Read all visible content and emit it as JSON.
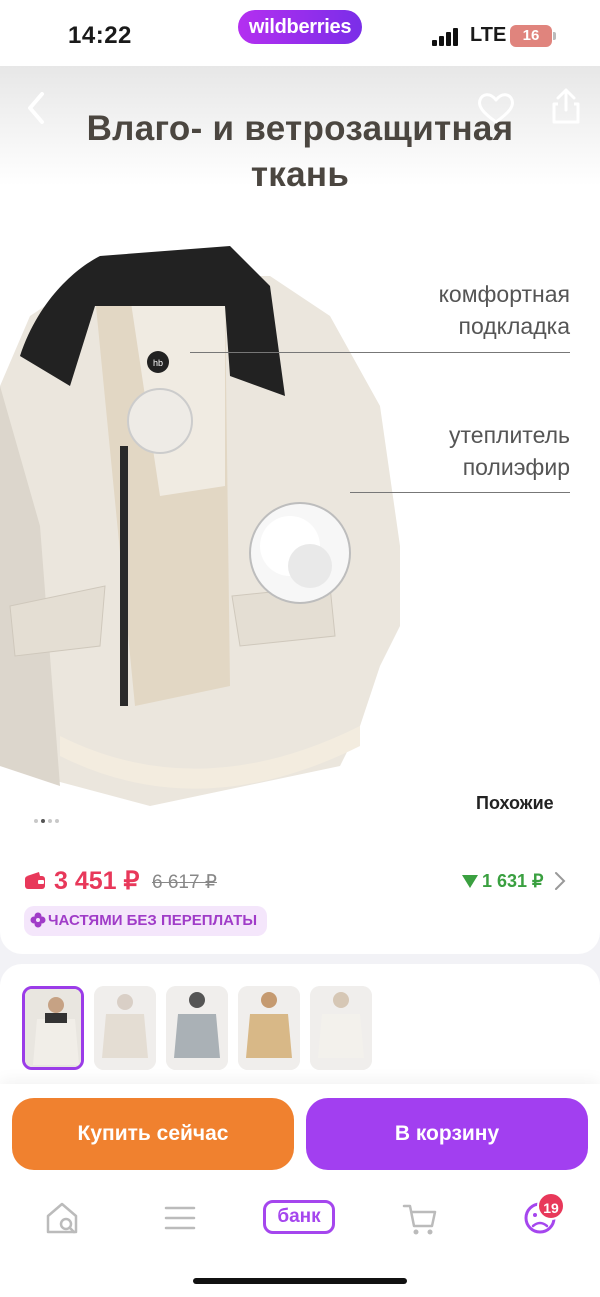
{
  "status_bar": {
    "time": "14:22",
    "brand": "wildberries",
    "network": "LTE",
    "battery": "16"
  },
  "gallery": {
    "headline_line1": "Влаго- и ветрозащитная",
    "headline_line2": "ткань",
    "callout_lining_line1": "комфортная",
    "callout_lining_line2": "подкладка",
    "callout_insulation_line1": "утеплитель",
    "callout_insulation_line2": "полиэфир",
    "similar_label": "Похожие",
    "brand_patch": "hb",
    "slide_index": 2,
    "slide_count": 4,
    "icons": [
      "back-icon",
      "heart-icon",
      "share-icon"
    ]
  },
  "price": {
    "current": "3 451 ₽",
    "old": "6 617 ₽",
    "discount": "1 631 ₽",
    "installment": "ЧАСТЯМИ БЕЗ ПЕРЕПЛАТЫ",
    "colors": {
      "price": "#e8385a",
      "discount": "#3aa040",
      "accent": "#a23ff0"
    }
  },
  "variants": {
    "count": 5,
    "selected_index": 0
  },
  "actions": {
    "buy_now": "Купить сейчас",
    "add_to_cart": "В корзину"
  },
  "tabbar": {
    "items": [
      "home-search-icon",
      "menu-icon",
      "bank-tab",
      "cart-icon",
      "profile-icon"
    ],
    "bank_label": "банк",
    "profile_badge": "19"
  }
}
